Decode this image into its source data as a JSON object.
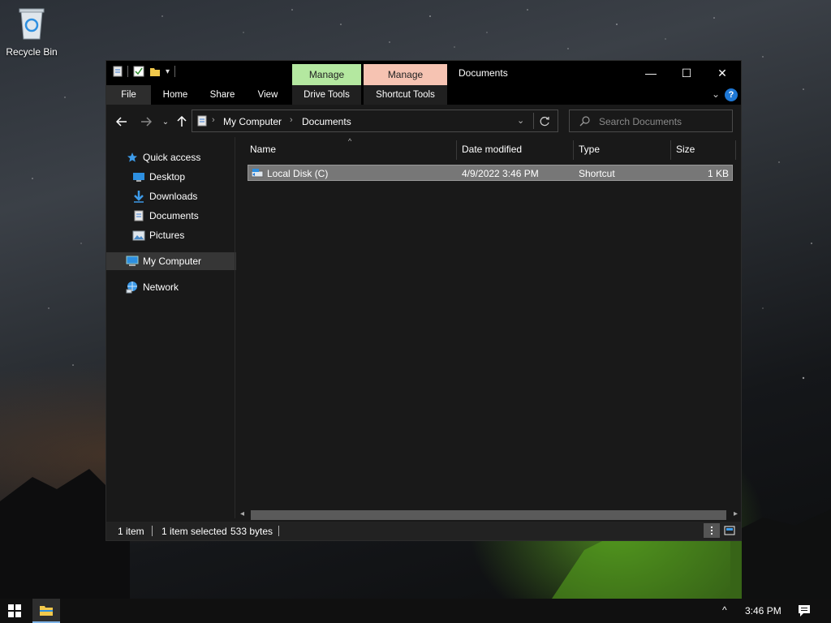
{
  "desktop": {
    "recycle_bin_label": "Recycle Bin"
  },
  "window": {
    "title": "Documents",
    "context_tabs": [
      {
        "label": "Manage",
        "color": "#b4e8a0"
      },
      {
        "label": "Manage",
        "color": "#f6c3b2"
      }
    ],
    "controls": {
      "minimize": "—",
      "maximize": "☐",
      "close": "✕"
    }
  },
  "ribbon": {
    "tabs": [
      "File",
      "Home",
      "Share",
      "View",
      "Drive Tools",
      "Shortcut Tools"
    ],
    "help": "?"
  },
  "navigation": {
    "breadcrumb": [
      "My Computer",
      "Documents"
    ],
    "search_placeholder": "Search Documents"
  },
  "nav_pane": {
    "quick_access": "Quick access",
    "pinned": [
      "Desktop",
      "Downloads",
      "Documents",
      "Pictures"
    ],
    "my_computer": "My Computer",
    "network": "Network"
  },
  "file_list": {
    "columns": [
      "Name",
      "Date modified",
      "Type",
      "Size"
    ],
    "rows": [
      {
        "name": "Local Disk (C)",
        "date": "4/9/2022 3:46 PM",
        "type": "Shortcut",
        "size": "1 KB"
      }
    ]
  },
  "status_bar": {
    "item_count": "1 item",
    "selected": "1 item selected",
    "size": "533 bytes"
  },
  "taskbar": {
    "time": "3:46 PM",
    "tray_chevron": "^"
  },
  "colors": {
    "accent": "#1e78d6",
    "selection": "#777777"
  }
}
